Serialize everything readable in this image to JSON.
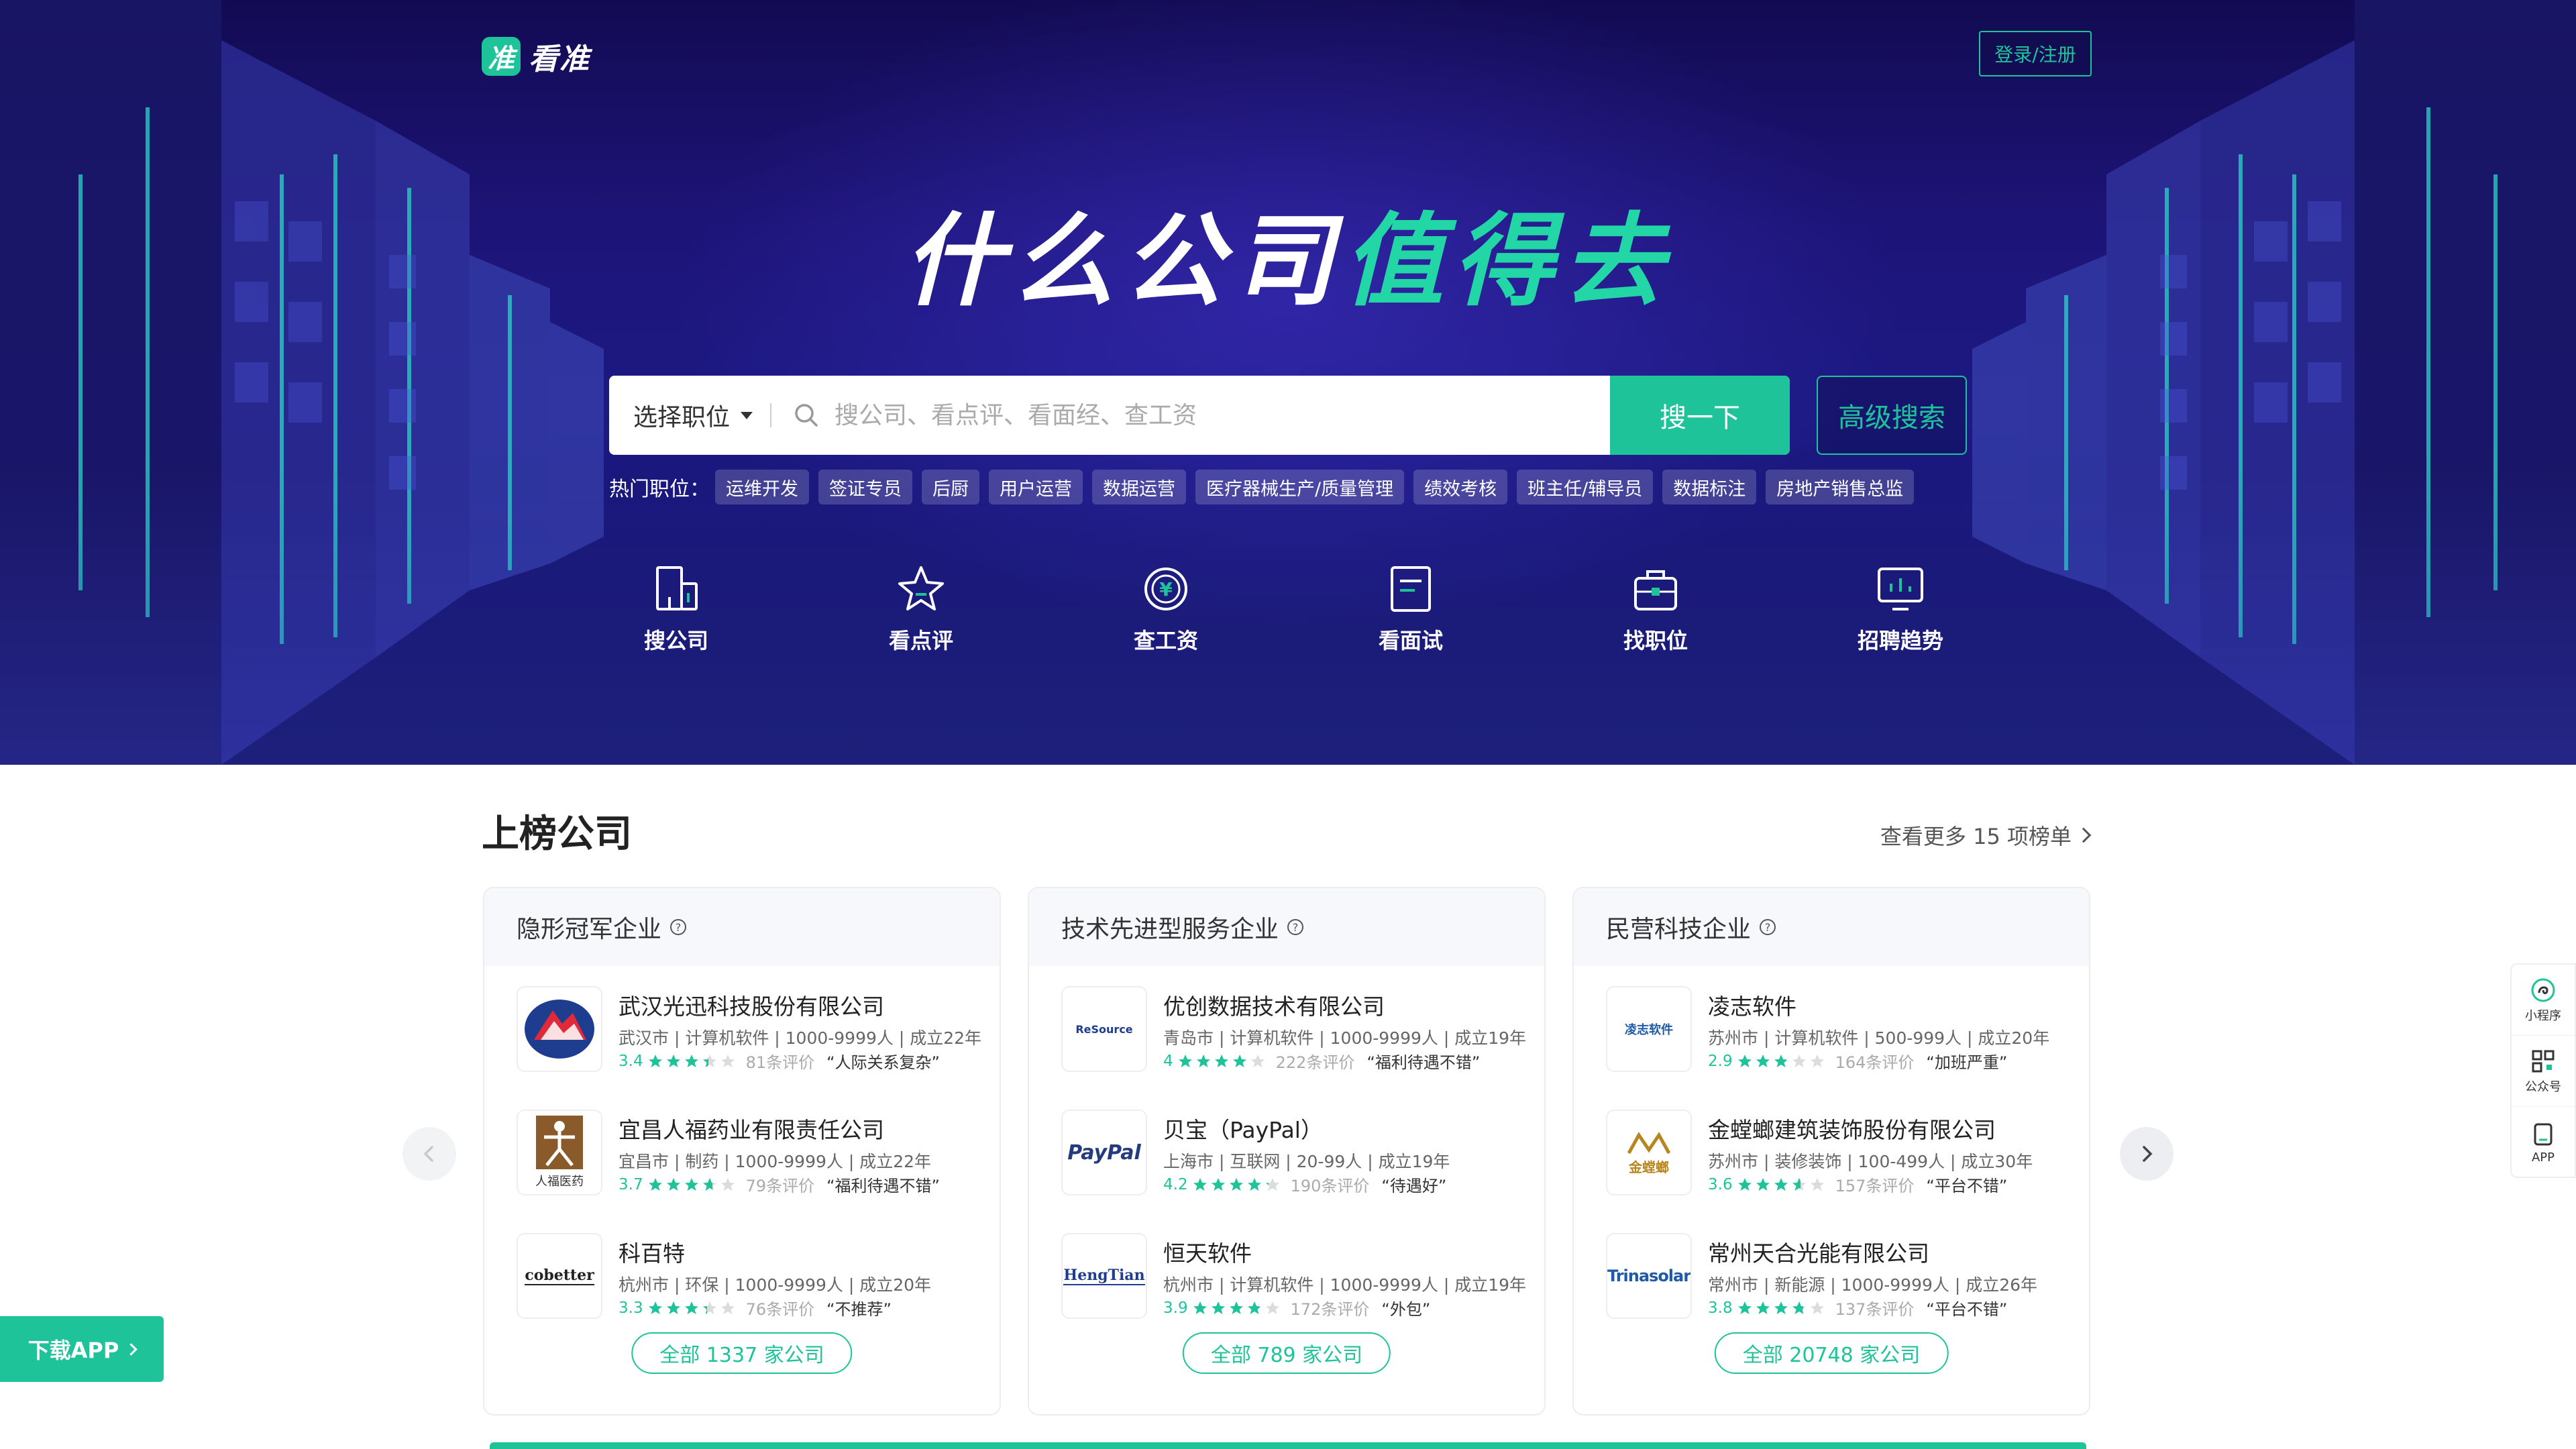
{
  "brand": {
    "logo_glyph": "准",
    "name": "看准",
    "accent": "#1fc39a"
  },
  "header": {
    "login_label": "登录/注册"
  },
  "hero": {
    "slogan_a": "什么公司",
    "slogan_b": "值得去"
  },
  "search": {
    "job_select": "选择职位",
    "placeholder": "搜公司、看点评、看面经、查工资",
    "button": "搜一下",
    "advanced": "高级搜索"
  },
  "hot_jobs": {
    "label": "热门职位：",
    "tags": [
      "运维开发",
      "签证专员",
      "后厨",
      "用户运营",
      "数据运营",
      "医疗器械生产/质量管理",
      "绩效考核",
      "班主任/辅导员",
      "数据标注",
      "房地产销售总监"
    ]
  },
  "features": [
    {
      "label": "搜公司",
      "icon": "building-icon"
    },
    {
      "label": "看点评",
      "icon": "star-icon"
    },
    {
      "label": "查工资",
      "icon": "yuan-coin-icon"
    },
    {
      "label": "看面试",
      "icon": "document-icon"
    },
    {
      "label": "找职位",
      "icon": "briefcase-icon"
    },
    {
      "label": "招聘趋势",
      "icon": "chart-monitor-icon"
    }
  ],
  "rank": {
    "title": "上榜公司",
    "see_more": "查看更多 15 项榜单",
    "cards": [
      {
        "title": "隐形冠军企业",
        "all_label": "全部 1337 家公司",
        "companies": [
          {
            "name": "武汉光迅科技股份有限公司",
            "info": "武汉市 | 计算机软件 | 1000-9999人 | 成立22年",
            "score": "3.4",
            "rating": 3.4,
            "reviews": "81条评价",
            "quote": "“人际关系复杂”"
          },
          {
            "name": "宜昌人福药业有限责任公司",
            "info": "宜昌市 | 制药 | 1000-9999人 | 成立22年",
            "score": "3.7",
            "rating": 3.7,
            "reviews": "79条评价",
            "quote": "“福利待遇不错”",
            "logo_text": "人福医药"
          },
          {
            "name": "科百特",
            "info": "杭州市 | 环保 | 1000-9999人 | 成立20年",
            "score": "3.3",
            "rating": 3.3,
            "reviews": "76条评价",
            "quote": "“不推荐”",
            "logo_text": "cobetter"
          }
        ]
      },
      {
        "title": "技术先进型服务企业",
        "all_label": "全部 789 家公司",
        "companies": [
          {
            "name": "优创数据技术有限公司",
            "info": "青岛市 | 计算机软件 | 1000-9999人 | 成立19年",
            "score": "4",
            "rating": 4.0,
            "reviews": "222条评价",
            "quote": "“福利待遇不错”",
            "logo_text": "ReSource"
          },
          {
            "name": "贝宝（PayPal）",
            "info": "上海市 | 互联网 | 20-99人 | 成立19年",
            "score": "4.2",
            "rating": 4.2,
            "reviews": "190条评价",
            "quote": "“待遇好”",
            "logo_text": "PayPal"
          },
          {
            "name": "恒天软件",
            "info": "杭州市 | 计算机软件 | 1000-9999人 | 成立19年",
            "score": "3.9",
            "rating": 3.9,
            "reviews": "172条评价",
            "quote": "“外包”",
            "logo_text": "HengTian"
          }
        ]
      },
      {
        "title": "民营科技企业",
        "all_label": "全部 20748 家公司",
        "companies": [
          {
            "name": "凌志软件",
            "info": "苏州市 | 计算机软件 | 500-999人 | 成立20年",
            "score": "2.9",
            "rating": 2.9,
            "reviews": "164条评价",
            "quote": "“加班严重”",
            "logo_text": "凌志软件"
          },
          {
            "name": "金螳螂建筑装饰股份有限公司",
            "info": "苏州市 | 装修装饰 | 100-499人 | 成立30年",
            "score": "3.6",
            "rating": 3.6,
            "reviews": "157条评价",
            "quote": "“平台不错”",
            "logo_text": "金螳螂"
          },
          {
            "name": "常州天合光能有限公司",
            "info": "常州市 | 新能源 | 1000-9999人 | 成立26年",
            "score": "3.8",
            "rating": 3.8,
            "reviews": "137条评价",
            "quote": "“平台不错”",
            "logo_text": "Trinasolar"
          }
        ]
      }
    ]
  },
  "side_bar": [
    {
      "label": "小程序",
      "icon": "mini-program-icon"
    },
    {
      "label": "公众号",
      "icon": "qr-code-icon"
    },
    {
      "label": "APP",
      "icon": "phone-app-icon"
    }
  ],
  "download": {
    "label": "下载APP"
  }
}
